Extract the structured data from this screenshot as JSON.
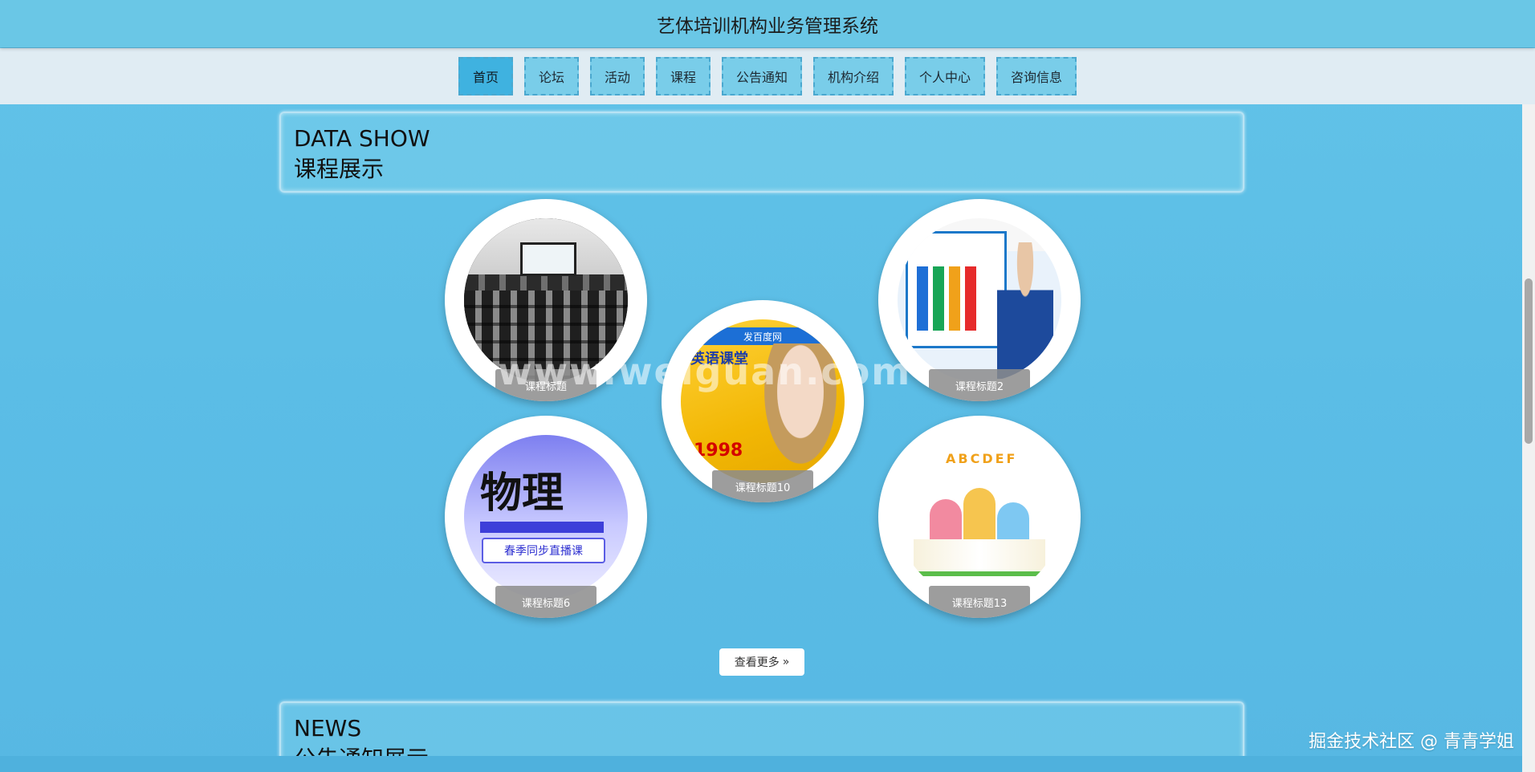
{
  "header": {
    "title": "艺体培训机构业务管理系统"
  },
  "nav": {
    "items": [
      {
        "label": "首页",
        "active": true
      },
      {
        "label": "论坛",
        "active": false
      },
      {
        "label": "活动",
        "active": false
      },
      {
        "label": "课程",
        "active": false
      },
      {
        "label": "公告通知",
        "active": false
      },
      {
        "label": "机构介绍",
        "active": false
      },
      {
        "label": "个人中心",
        "active": false
      },
      {
        "label": "咨询信息",
        "active": false
      }
    ]
  },
  "data_show": {
    "en": "DATA SHOW",
    "cn": "课程展示"
  },
  "courses": [
    {
      "caption": "课程标题",
      "image": "classroom"
    },
    {
      "caption": "课程标题2",
      "image": "english-natural-phonics"
    },
    {
      "caption": "课程标题10",
      "image": "english-course-ad"
    },
    {
      "caption": "课程标题6",
      "image": "physics"
    },
    {
      "caption": "课程标题13",
      "image": "kids-reading"
    }
  ],
  "course_images": {
    "english_banner": "发百度网",
    "english_text": "英语课堂",
    "english_price": "1998",
    "physics_title": "物理",
    "physics_subtitle": "春季同步直播课",
    "kids_letters": "ABCDEF"
  },
  "more_button": {
    "label": "查看更多"
  },
  "news": {
    "en": "NEWS",
    "cn": "公告通知展示"
  },
  "watermark": {
    "text": "www.weiguan.com"
  },
  "juejin": {
    "text": "掘金技术社区 @ 青青学姐"
  },
  "colors": {
    "header_bg": "#6ac7e6",
    "nav_bg": "#e0ecf3",
    "nav_active": "#3fb2e0",
    "page_bg": "#5bbde6"
  }
}
